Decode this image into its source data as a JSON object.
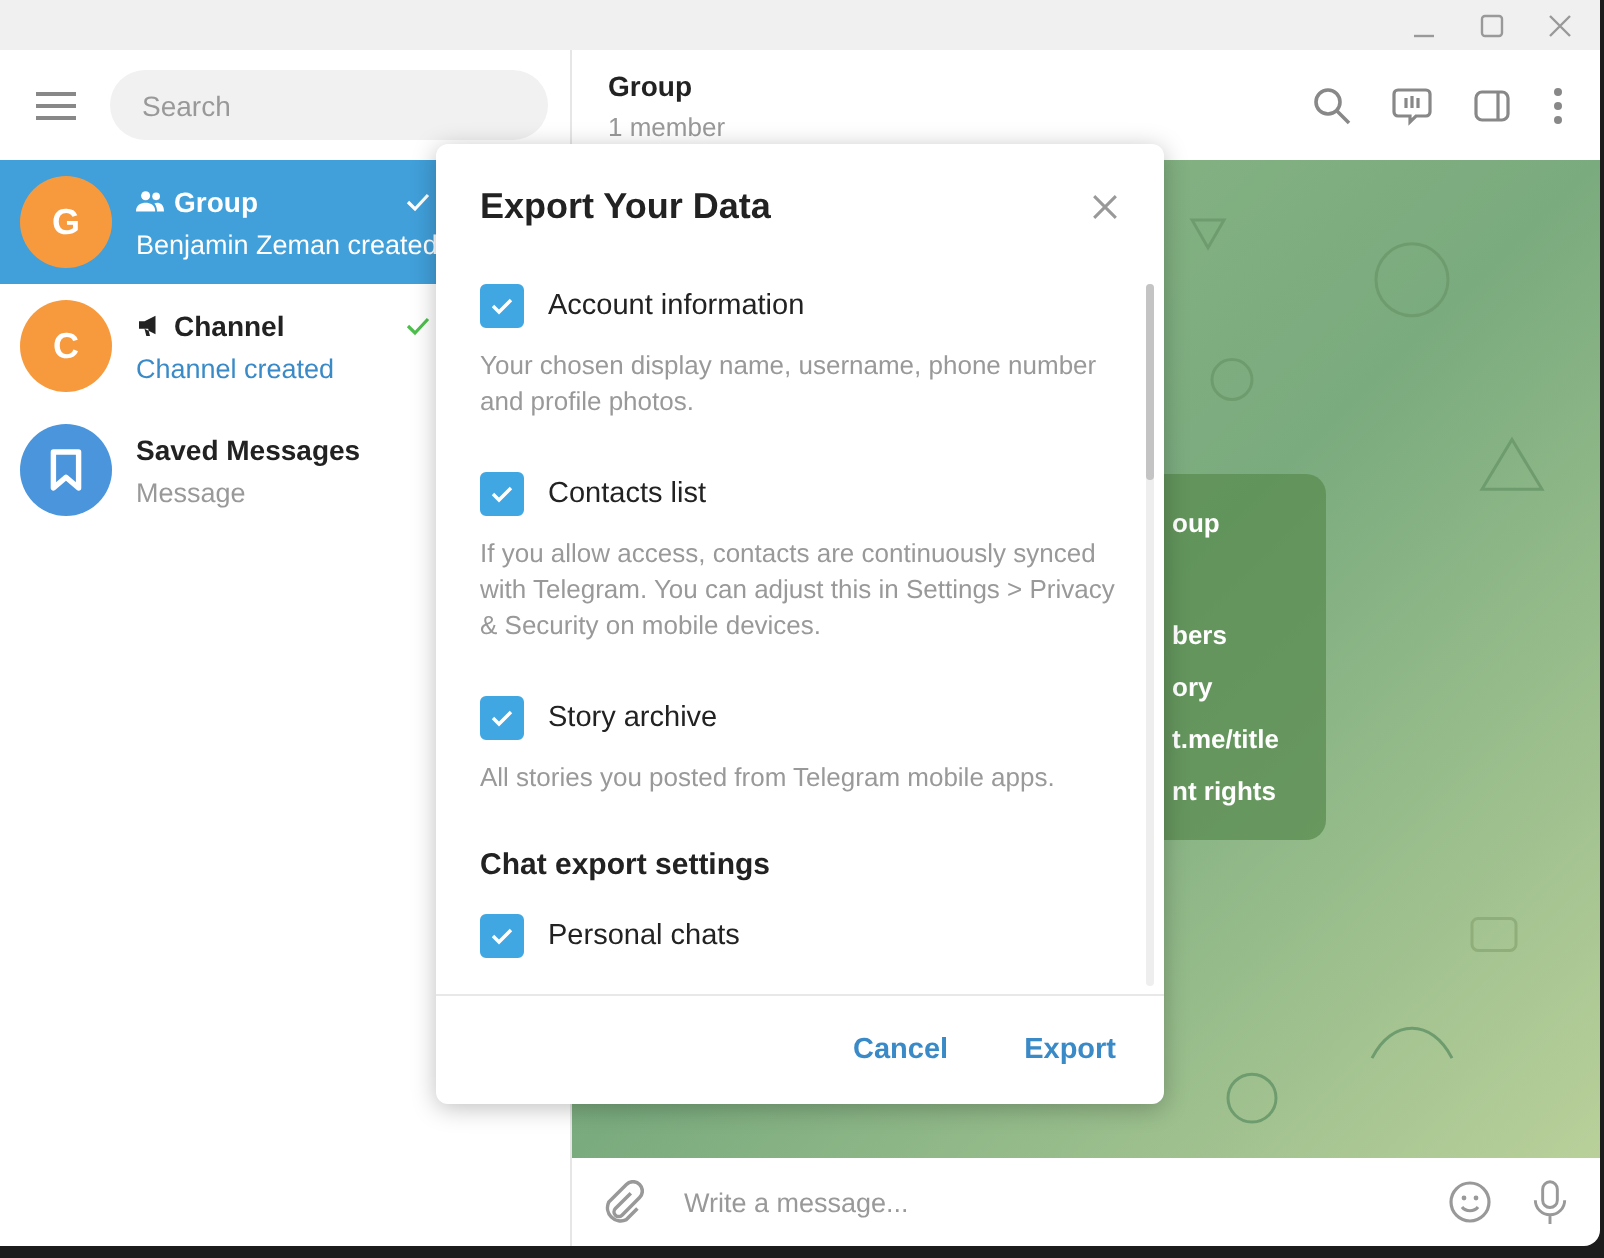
{
  "sidebar": {
    "search": {
      "placeholder": "Search"
    },
    "chats": [
      {
        "kind": "group",
        "avatar_letter": "G",
        "color": "#f79a3e",
        "name": "Group",
        "preview": "Benjamin Zeman created",
        "preview_highlight": false,
        "read": true,
        "selected": true
      },
      {
        "kind": "channel",
        "avatar_letter": "C",
        "color": "#f79a3e",
        "name": "Channel",
        "preview": "Channel created",
        "preview_highlight": true,
        "read": true,
        "selected": false
      },
      {
        "kind": "saved",
        "color": "#4a95dc",
        "name": "Saved Messages",
        "preview": "Message",
        "preview_highlight": false,
        "read": false,
        "selected": false
      }
    ]
  },
  "chat": {
    "title": "Group",
    "subtitle": "1 member",
    "info_card": {
      "lines": [
        "oup",
        "bers",
        "ory",
        "t.me/title",
        "nt rights"
      ]
    },
    "composer": {
      "placeholder": "Write a message..."
    }
  },
  "dialog": {
    "title": "Export Your Data",
    "items": [
      {
        "kind": "checkbox",
        "label": "Account information",
        "checked": true,
        "description": "Your chosen display name, username, phone number and profile photos."
      },
      {
        "kind": "checkbox",
        "label": "Contacts list",
        "checked": true,
        "description": "If you allow access, contacts are continuously synced with Telegram. You can adjust this in Settings > Privacy & Security on mobile devices."
      },
      {
        "kind": "checkbox",
        "label": "Story archive",
        "checked": true,
        "description": "All stories you posted from Telegram mobile apps."
      },
      {
        "kind": "heading",
        "label": "Chat export settings"
      },
      {
        "kind": "checkbox",
        "label": "Personal chats",
        "checked": true
      }
    ],
    "buttons": [
      "Cancel",
      "Export"
    ]
  }
}
